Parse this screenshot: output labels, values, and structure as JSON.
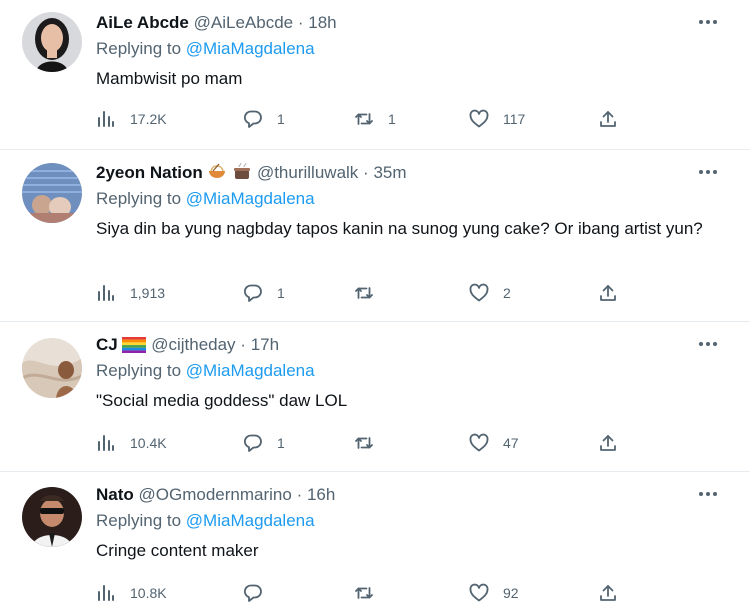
{
  "tweets": [
    {
      "name": "AiLe Abcde",
      "handle": "@AiLeAbcde",
      "sep": "·",
      "time": "18h",
      "replying_prefix": "Replying to",
      "replying_to": "@MiaMagdalena",
      "text": "Mambwisit po mam",
      "views": "17.2K",
      "replies": "1",
      "retweets": "1",
      "likes": "117"
    },
    {
      "name": "2yeon Nation",
      "handle": "@thurilluwalk",
      "sep": "·",
      "time": "35m",
      "replying_prefix": "Replying to",
      "replying_to": "@MiaMagdalena",
      "text": "Siya din ba yung nagbday tapos kanin na sunog yung cake? Or ibang artist yun?",
      "views": "1,913",
      "replies": "1",
      "retweets": "",
      "likes": "2"
    },
    {
      "name": "CJ",
      "handle": "@cijtheday",
      "sep": "·",
      "time": "17h",
      "replying_prefix": "Replying to",
      "replying_to": "@MiaMagdalena",
      "text": "\"Social media goddess\" daw LOL",
      "views": "10.4K",
      "replies": "1",
      "retweets": "",
      "likes": "47"
    },
    {
      "name": "Nato",
      "handle": "@OGmodernmarino",
      "sep": "·",
      "time": "16h",
      "replying_prefix": "Replying to",
      "replying_to": "@MiaMagdalena",
      "text": "Cringe content maker",
      "views": "10.8K",
      "replies": "",
      "retweets": "",
      "likes": "92"
    }
  ],
  "icons": {
    "views": "views-chart-icon",
    "reply": "reply-bubble-icon",
    "retweet": "retweet-icon",
    "like": "heart-icon",
    "share": "share-upload-icon",
    "more": "more-dots-icon"
  },
  "colors": {
    "link": "#1d9bf0",
    "muted": "#536471",
    "text": "#0f1419",
    "divider": "#e6ecf0"
  }
}
